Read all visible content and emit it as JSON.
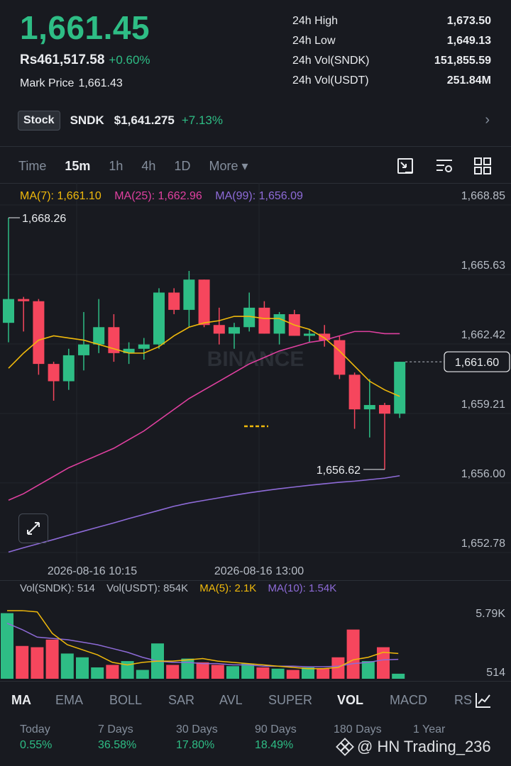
{
  "header": {
    "last_price": "1,661.45",
    "fiat_price": "Rs461,517.58",
    "change_pct": "+0.60%",
    "mark_price_label": "Mark Price",
    "mark_price": "1,661.43"
  },
  "stats": [
    {
      "label": "24h High",
      "value": "1,673.50"
    },
    {
      "label": "24h Low",
      "value": "1,649.13"
    },
    {
      "label": "24h Vol(SNDK)",
      "value": "151,855.59"
    },
    {
      "label": "24h Vol(USDT)",
      "value": "251.84M"
    }
  ],
  "stock": {
    "badge": "Stock",
    "symbol": "SNDK",
    "price": "$1,641.275",
    "change": "+7.13%",
    "chevron": "›"
  },
  "timeframes": [
    "Time",
    "15m",
    "1h",
    "4h",
    "1D",
    "More ▾"
  ],
  "active_timeframe": "15m",
  "ma_legend": {
    "ma7": "MA(7): 1,661.10",
    "ma25": "MA(25): 1,662.96",
    "ma99": "MA(99): 1,656.09"
  },
  "price_axis": [
    "1,668.85",
    "1,665.63",
    "1,662.42",
    "1,659.21",
    "1,656.00",
    "1,652.78"
  ],
  "time_axis": [
    "2026-08-16 10:15",
    "2026-08-16 13:00"
  ],
  "annotations": {
    "high": "1,668.26",
    "low": "1,656.62",
    "current": "1,661.60",
    "watermark_chart": "BINANCE"
  },
  "vol_legend": {
    "vol_base": "Vol(SNDK): 514",
    "vol_quote": "Vol(USDT): 854K",
    "ma5": "MA(5): 2.1K",
    "ma10": "MA(10): 1.54K"
  },
  "vol_axis": [
    "5.79K",
    "514"
  ],
  "indicators": [
    "MA",
    "EMA",
    "BOLL",
    "SAR",
    "AVL",
    "SUPER",
    "VOL",
    "MACD",
    "RS"
  ],
  "performance": [
    {
      "label": "Today",
      "value": "0.55%"
    },
    {
      "label": "7 Days",
      "value": "36.58%"
    },
    {
      "label": "30 Days",
      "value": "17.80%"
    },
    {
      "label": "90 Days",
      "value": "18.49%"
    },
    {
      "label": "180 Days",
      "value": ""
    },
    {
      "label": "1 Year",
      "value": ""
    }
  ],
  "footer_watermark": "@ HN Trading_236",
  "colors": {
    "up": "#2ebd85",
    "down": "#f6465d",
    "ma7": "#f0b90b",
    "ma25": "#e040a0",
    "ma99": "#8e6bd8"
  },
  "chart_data": {
    "type": "candlestick",
    "interval": "15m",
    "y_range": [
      1652.78,
      1668.85
    ],
    "candles": [
      {
        "o": 1663.4,
        "h": 1668.26,
        "l": 1662.5,
        "c": 1664.5
      },
      {
        "o": 1664.5,
        "h": 1664.6,
        "l": 1663.0,
        "c": 1664.4
      },
      {
        "o": 1664.4,
        "h": 1664.5,
        "l": 1661.0,
        "c": 1661.5
      },
      {
        "o": 1661.5,
        "h": 1661.6,
        "l": 1659.8,
        "c": 1660.7
      },
      {
        "o": 1660.7,
        "h": 1662.2,
        "l": 1660.3,
        "c": 1661.9
      },
      {
        "o": 1661.9,
        "h": 1663.9,
        "l": 1661.2,
        "c": 1662.4
      },
      {
        "o": 1662.4,
        "h": 1664.5,
        "l": 1662.0,
        "c": 1663.2
      },
      {
        "o": 1663.2,
        "h": 1663.8,
        "l": 1661.6,
        "c": 1662.0
      },
      {
        "o": 1662.0,
        "h": 1662.5,
        "l": 1661.5,
        "c": 1662.2
      },
      {
        "o": 1662.2,
        "h": 1662.7,
        "l": 1661.7,
        "c": 1662.4
      },
      {
        "o": 1662.4,
        "h": 1665.0,
        "l": 1662.2,
        "c": 1664.8
      },
      {
        "o": 1664.8,
        "h": 1665.0,
        "l": 1663.8,
        "c": 1664.0
      },
      {
        "o": 1664.0,
        "h": 1665.8,
        "l": 1663.2,
        "c": 1665.4
      },
      {
        "o": 1665.4,
        "h": 1665.4,
        "l": 1663.2,
        "c": 1663.3
      },
      {
        "o": 1663.3,
        "h": 1664.1,
        "l": 1662.4,
        "c": 1662.9
      },
      {
        "o": 1662.9,
        "h": 1663.4,
        "l": 1662.2,
        "c": 1663.2
      },
      {
        "o": 1663.2,
        "h": 1664.8,
        "l": 1663.0,
        "c": 1664.1
      },
      {
        "o": 1664.1,
        "h": 1664.4,
        "l": 1662.9,
        "c": 1662.9
      },
      {
        "o": 1662.9,
        "h": 1663.9,
        "l": 1662.4,
        "c": 1663.8
      },
      {
        "o": 1663.8,
        "h": 1664.0,
        "l": 1662.8,
        "c": 1662.8
      },
      {
        "o": 1662.8,
        "h": 1663.1,
        "l": 1662.5,
        "c": 1662.9
      },
      {
        "o": 1662.9,
        "h": 1663.3,
        "l": 1662.3,
        "c": 1662.6
      },
      {
        "o": 1662.6,
        "h": 1662.8,
        "l": 1660.8,
        "c": 1661.0
      },
      {
        "o": 1661.0,
        "h": 1661.1,
        "l": 1658.5,
        "c": 1659.4
      },
      {
        "o": 1659.4,
        "h": 1660.8,
        "l": 1658.1,
        "c": 1659.6
      },
      {
        "o": 1659.6,
        "h": 1659.7,
        "l": 1656.62,
        "c": 1659.2
      },
      {
        "o": 1659.2,
        "h": 1661.6,
        "l": 1659.0,
        "c": 1661.6
      }
    ],
    "ma7": [
      1661.3,
      1662.0,
      1662.6,
      1662.8,
      1662.7,
      1662.6,
      1662.4,
      1662.2,
      1662.0,
      1662.0,
      1662.3,
      1662.8,
      1663.2,
      1663.4,
      1663.5,
      1663.7,
      1663.7,
      1663.6,
      1663.6,
      1663.3,
      1663.1,
      1662.7,
      1662.1,
      1661.4,
      1660.7,
      1660.3,
      1660.0
    ],
    "ma25": [
      1655.2,
      1655.5,
      1655.9,
      1656.3,
      1656.7,
      1657.0,
      1657.3,
      1657.6,
      1658.0,
      1658.4,
      1658.9,
      1659.4,
      1659.9,
      1660.3,
      1660.7,
      1661.1,
      1661.5,
      1661.8,
      1662.1,
      1662.3,
      1662.5,
      1662.6,
      1662.8,
      1663.0,
      1663.0,
      1662.9,
      1662.9
    ],
    "ma99": [
      1652.8,
      1653.0,
      1653.19,
      1653.38,
      1653.58,
      1653.77,
      1653.96,
      1654.15,
      1654.35,
      1654.54,
      1654.73,
      1654.92,
      1655.07,
      1655.19,
      1655.31,
      1655.43,
      1655.54,
      1655.64,
      1655.73,
      1655.81,
      1655.89,
      1655.96,
      1656.03,
      1656.08,
      1656.15,
      1656.22,
      1656.33
    ],
    "volume_range": [
      0,
      5790
    ],
    "volumes": [
      5200,
      2600,
      2500,
      3100,
      2000,
      1700,
      900,
      1100,
      1400,
      700,
      2800,
      1100,
      1600,
      1300,
      1100,
      1000,
      1200,
      900,
      800,
      700,
      900,
      800,
      1700,
      3900,
      1400,
      2500,
      400
    ],
    "vol_ma5": [
      5400,
      5400,
      5300,
      3600,
      2700,
      2300,
      1900,
      1300,
      1100,
      1300,
      1400,
      1400,
      1500,
      1600,
      1400,
      1300,
      1200,
      1100,
      1000,
      900,
      800,
      800,
      900,
      1500,
      1700,
      2100,
      2000
    ],
    "vol_ma10": [
      4400,
      3900,
      3300,
      3200,
      3100,
      2900,
      2700,
      2400,
      2100,
      1700,
      1400,
      1300,
      1300,
      1200,
      1200,
      1100,
      1100,
      1000,
      1000,
      1000,
      950,
      950,
      1000,
      1200,
      1300,
      1500,
      1540
    ]
  }
}
